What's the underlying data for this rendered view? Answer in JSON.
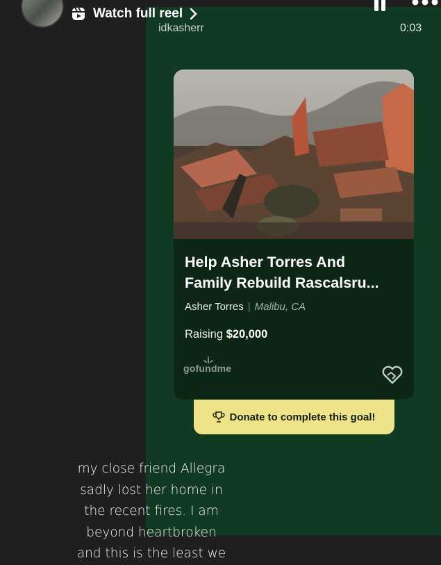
{
  "header": {
    "reel_link": "Watch full reel",
    "username": "idkasherr",
    "timestamp": "0:03"
  },
  "card": {
    "title_line1": "Help Asher Torres And",
    "title_line2": "Family Rebuild Rascalsru...",
    "organizer": "Asher Torres",
    "location": "Malibu, CA",
    "raising_label": "Raising",
    "raising_amount": "$20,000",
    "brand": "gofundme",
    "photo_icon": "burned-house-rubble-photo"
  },
  "donate_button": {
    "label": "Donate to complete this goal!",
    "icon": "trophy-icon"
  },
  "caption": {
    "lines": [
      "my close friend Allegra",
      "sadly lost her home in",
      "the recent fires. I am",
      "beyond heartbroken",
      "and this is the least we"
    ]
  },
  "colors": {
    "background": "#1f1f1f",
    "panel_green": "#103a22",
    "card_bg": "#0e2616",
    "donate_yellow": "#efe38a"
  }
}
